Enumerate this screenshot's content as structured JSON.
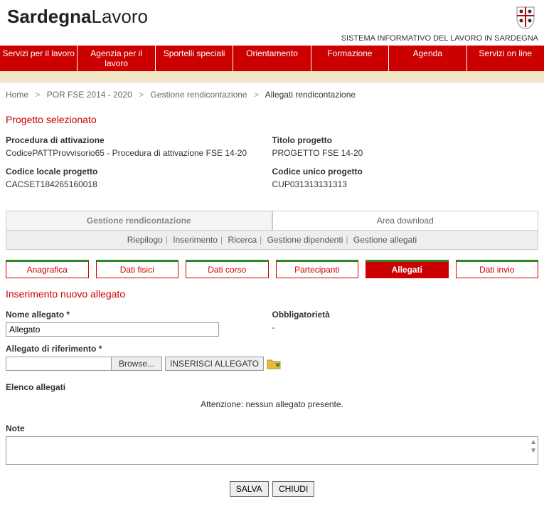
{
  "logo": {
    "bold": "Sardegna",
    "light": "Lavoro"
  },
  "tagline": "SISTEMA INFORMATIVO DEL LAVORO IN SARDEGNA",
  "nav": [
    "Servizi per il lavoro",
    "Agenzia per il lavoro",
    "Sportelli speciali",
    "Orientamento",
    "Formazione",
    "Agenda",
    "Servizi on line"
  ],
  "breadcrumb": {
    "items": [
      "Home",
      "POR FSE 2014 - 2020",
      "Gestione rendicontazione"
    ],
    "current": "Allegati rendicontazione",
    "sep": ">"
  },
  "progetto": {
    "title": "Progetto selezionato",
    "fields": {
      "proc_label": "Procedura di attivazione",
      "proc_value": "CodicePATTProvvisorio65 - Procedura di attivazione FSE 14-20",
      "titolo_label": "Titolo progetto",
      "titolo_value": "PROGETTO FSE 14-20",
      "codloc_label": "Codice locale progetto",
      "codloc_value": "CACSET184265160018",
      "codun_label": "Codice unico progetto",
      "codun_value": "CUP031313131313"
    }
  },
  "tabs_main": {
    "active": "Gestione rendicontazione",
    "inactive": "Area download"
  },
  "subnav": [
    "Riepilogo",
    "Inserimento",
    "Ricerca",
    "Gestione dipendenti",
    "Gestione allegati"
  ],
  "pills": [
    "Anagrafica",
    "Dati fisici",
    "Dati corso",
    "Partecipanti",
    "Allegati",
    "Dati invio"
  ],
  "pill_active_index": 4,
  "form": {
    "title": "Inserimento nuovo allegato",
    "nome_label": "Nome allegato *",
    "nome_value": "Allegato",
    "obbl_label": "Obbligatorietà",
    "obbl_value": "-",
    "rif_label": "Allegato di riferimento *",
    "browse": "Browse...",
    "insert": "INSERISCI ALLEGATO"
  },
  "elenco": {
    "label": "Elenco allegati",
    "msg": "Attenzione: nessun allegato presente."
  },
  "note_label": "Note",
  "actions": {
    "salva": "SALVA",
    "chiudi": "CHIUDI"
  }
}
